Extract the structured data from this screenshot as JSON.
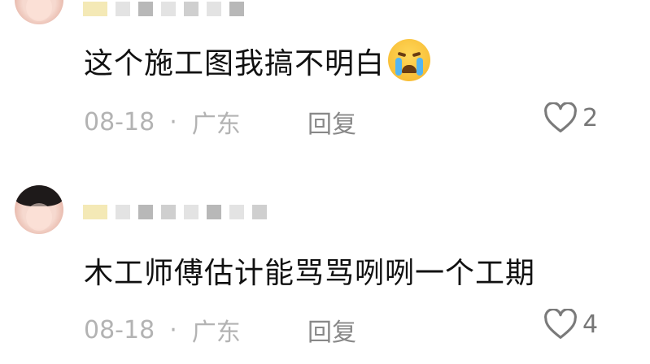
{
  "comments": [
    {
      "text": "这个施工图我搞不明白",
      "emoji": "loudly-crying-face",
      "date": "08-18",
      "separator": "·",
      "location": "广东",
      "reply_label": "回复",
      "like_count": "2"
    },
    {
      "text": "木工师傅估计能骂骂咧咧一个工期",
      "date": "08-18",
      "separator": "·",
      "location": "广东",
      "reply_label": "回复",
      "like_count": "4"
    }
  ],
  "colors": {
    "text": "#111111",
    "meta": "#b3b3b3",
    "reply": "#888888",
    "heart": "#7a7a7a"
  }
}
